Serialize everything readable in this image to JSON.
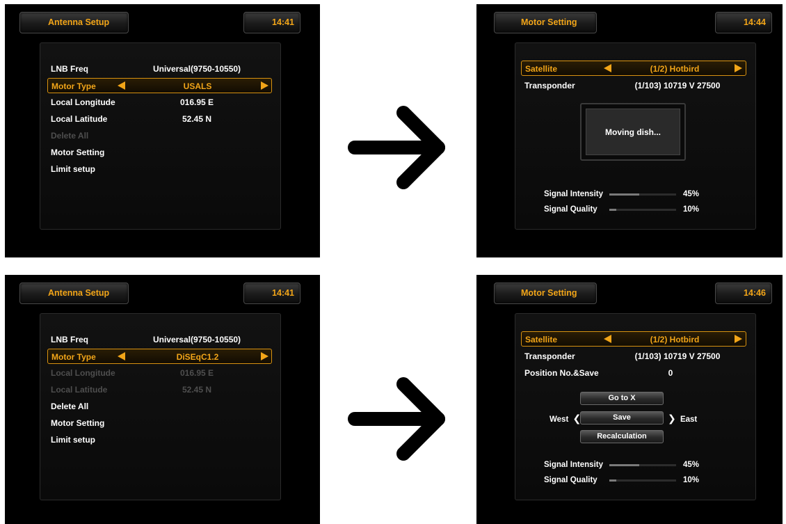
{
  "screens": {
    "tl": {
      "title": "Antenna Setup",
      "time": "14:41",
      "rows": [
        {
          "label": "LNB Freq",
          "value": "Universal(9750-10550)"
        },
        {
          "label": "Motor Type",
          "value": "USALS"
        },
        {
          "label": "Local Longitude",
          "value": "016.95 E"
        },
        {
          "label": "Local Latitude",
          "value": "52.45 N"
        },
        {
          "label": "Delete All",
          "value": ""
        },
        {
          "label": "Motor Setting",
          "value": ""
        },
        {
          "label": "Limit setup",
          "value": ""
        }
      ]
    },
    "tr": {
      "title": "Motor Setting",
      "time": "14:44",
      "satellite_label": "Satellite",
      "satellite_value": "(1/2) Hotbird",
      "transponder_label": "Transponder",
      "transponder_value": "(1/103) 10719 V 27500",
      "popup_text": "Moving dish...",
      "signal_intensity_label": "Signal Intensity",
      "signal_intensity_value": "45%",
      "signal_intensity": 0.45,
      "signal_quality_label": "Signal Quality",
      "signal_quality_value": "10%",
      "signal_quality": 0.1
    },
    "bl": {
      "title": "Antenna Setup",
      "time": "14:41",
      "rows": [
        {
          "label": "LNB Freq",
          "value": "Universal(9750-10550)"
        },
        {
          "label": "Motor Type",
          "value": "DiSEqC1.2"
        },
        {
          "label": "Local Longitude",
          "value": "016.95 E"
        },
        {
          "label": "Local Latitude",
          "value": "52.45 N"
        },
        {
          "label": "Delete All",
          "value": ""
        },
        {
          "label": "Motor Setting",
          "value": ""
        },
        {
          "label": "Limit setup",
          "value": ""
        }
      ]
    },
    "br": {
      "title": "Motor Setting",
      "time": "14:46",
      "satellite_label": "Satellite",
      "satellite_value": "(1/2) Hotbird",
      "transponder_label": "Transponder",
      "transponder_value": "(1/103) 10719 V 27500",
      "position_label": "Position No.&Save",
      "position_value": "0",
      "goto_label": "Go to X",
      "save_label": "Save",
      "recalc_label": "Recalculation",
      "west_label": "West",
      "east_label": "East",
      "signal_intensity_label": "Signal Intensity",
      "signal_intensity_value": "45%",
      "signal_intensity": 0.45,
      "signal_quality_label": "Signal Quality",
      "signal_quality_value": "10%",
      "signal_quality": 0.1
    }
  },
  "colors": {
    "accent": "#f2a518",
    "screen_bg": "#000000",
    "disabled_text": "#4e4e4e",
    "arrow": "#000000"
  },
  "icons": [
    "right-arrow-icon",
    "left-chevron-icon",
    "right-chevron-icon",
    "left-triangle-icon",
    "right-triangle-icon"
  ]
}
